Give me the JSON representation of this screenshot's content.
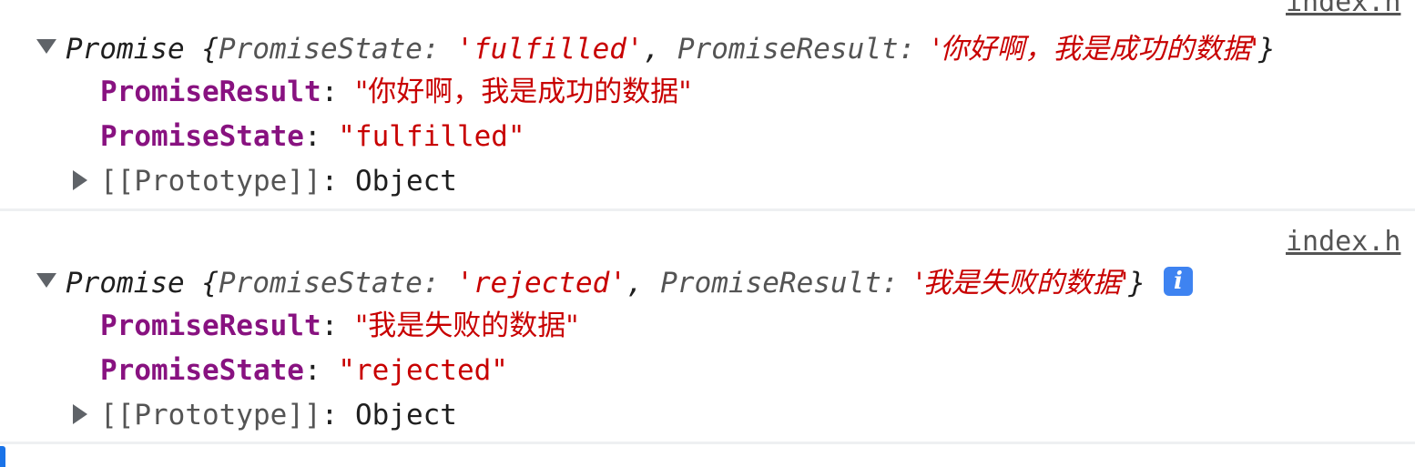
{
  "console": {
    "entries": [
      {
        "source": "index.h",
        "summary": {
          "type_name": "Promise",
          "open_brace": "{",
          "state_key": "PromiseState",
          "colon": ": ",
          "state_value": "'fulfilled'",
          "comma": ", ",
          "result_key": "PromiseResult",
          "result_value": "'你好啊，我是成功的数据'",
          "close_brace": "}"
        },
        "properties": [
          {
            "key": "PromiseResult",
            "sep": ": ",
            "value": "\"你好啊，我是成功的数据\""
          },
          {
            "key": "PromiseState",
            "sep": ": ",
            "value": "\"fulfilled\""
          }
        ],
        "prototype": {
          "key": "[[Prototype]]",
          "sep": ": ",
          "value": "Object"
        }
      },
      {
        "source": "index.h",
        "summary": {
          "type_name": "Promise",
          "open_brace": "{",
          "state_key": "PromiseState",
          "colon": ": ",
          "state_value": "'rejected'",
          "comma": ", ",
          "result_key": "PromiseResult",
          "result_value": "'我是失败的数据'",
          "close_brace": "}"
        },
        "info_icon_glyph": "i",
        "properties": [
          {
            "key": "PromiseResult",
            "sep": ": ",
            "value": "\"我是失败的数据\""
          },
          {
            "key": "PromiseState",
            "sep": ": ",
            "value": "\"rejected\""
          }
        ],
        "prototype": {
          "key": "[[Prototype]]",
          "sep": ": ",
          "value": "Object"
        }
      }
    ]
  },
  "colors": {
    "string": "#c80000",
    "property_key": "#881280",
    "dim_text": "#545454",
    "info_badge": "#3e83f1",
    "divider": "#eef0f2"
  }
}
